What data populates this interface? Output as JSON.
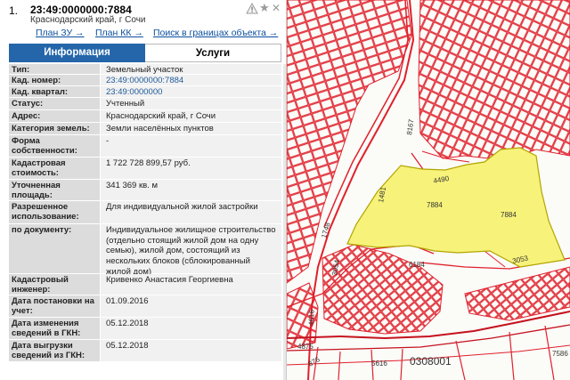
{
  "header": {
    "index": "1.",
    "cad_number": "23:49:0000000:7884",
    "address": "Краснодарский край, г Сочи"
  },
  "links": {
    "plan_zu": "План ЗУ →",
    "plan_kk": "План КК →",
    "search_bounds": "Поиск в границах объекта →"
  },
  "tabs": [
    {
      "label": "Информация"
    },
    {
      "label": "Услуги"
    }
  ],
  "rows": [
    {
      "label": "Тип:",
      "value": "Земельный участок"
    },
    {
      "label": "Кад. номер:",
      "value": "23:49:0000000:7884"
    },
    {
      "label": "Кад. квартал:",
      "value": "23:49:0000000"
    },
    {
      "label": "Статус:",
      "value": "Учтенный"
    },
    {
      "label": "Адрес:",
      "value": "Краснодарский край, г Сочи"
    },
    {
      "label": "Категория земель:",
      "value": "Земли населённых пунктов"
    },
    {
      "label": "Форма собственности:",
      "value": "-"
    },
    {
      "label": "Кадастровая стоимость:",
      "value": "1 722 728 899,57 руб."
    },
    {
      "label": "Уточненная площадь:",
      "value": "341 369 кв. м"
    },
    {
      "label": "Разрешенное использование:",
      "value": "Для индивидуальной жилой застройки"
    },
    {
      "label": "по документу:",
      "value": "Индивидуальное жилищное строительство (отдельно стоящий жилой дом на одну семью), жилой дом, состоящий из нескольких блоков (сблокированный жилой дом)"
    },
    {
      "label": "Кадастровый инженер:",
      "value": "Кривенко Анастасия Георгиевна"
    },
    {
      "label": "Дата постановки на учет:",
      "value": "01.09.2016"
    },
    {
      "label": "Дата изменения сведений в ГКН:",
      "value": "05.12.2018"
    },
    {
      "label": "Дата выгрузки сведений из ГКН:",
      "value": "05.12.2018"
    }
  ],
  "map": {
    "labels": [
      "8167",
      "4490",
      "1481",
      "7884",
      "7884",
      "1748",
      "3054",
      "6184",
      "3053",
      "4616",
      "4875",
      "5616",
      "0308001",
      "876",
      "7586"
    ],
    "colors": {
      "parcel_fill": "#f7f27a",
      "parcel_stroke": "#b3a500",
      "boundary": "#e0202b",
      "road": "#c5121e"
    }
  },
  "icons": [
    "warning-icon",
    "star-icon",
    "close-icon"
  ]
}
